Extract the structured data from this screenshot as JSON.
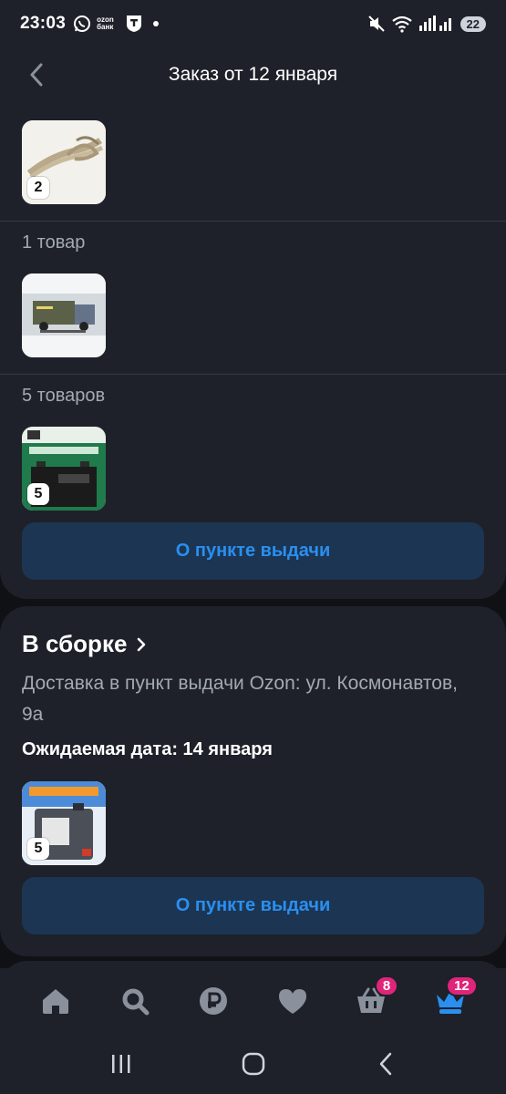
{
  "status_bar": {
    "time": "23:03",
    "ozon_label": "ozon банк",
    "battery": "22",
    "icons": [
      "whatsapp-icon",
      "ozon-bank-icon",
      "t-bank-icon",
      "mute-icon",
      "wifi-icon",
      "signal-icon"
    ]
  },
  "header": {
    "title": "Заказ от 12 января",
    "back_icon": "chevron-left-icon"
  },
  "order_card": {
    "items": [
      {
        "name": "product-rope",
        "qty": "2"
      },
      {
        "name": "product-truck-cover",
        "qty": ""
      },
      {
        "name": "product-battery",
        "qty": "5"
      }
    ],
    "group_labels": [
      "1 товар",
      "5 товаров"
    ],
    "pickup_button": "О пункте выдачи"
  },
  "assembly_card": {
    "status": "В сборке",
    "address": "Доставка в пункт выдачи Ozon: ул. Космонавтов, 9а",
    "expected_date": "Ожидаемая дата: 14 января",
    "item_qty": "5",
    "pickup_button": "О пункте выдачи"
  },
  "bottom_nav": {
    "items": [
      {
        "name": "home-icon"
      },
      {
        "name": "search-icon"
      },
      {
        "name": "ruble-icon"
      },
      {
        "name": "heart-icon"
      },
      {
        "name": "basket-icon",
        "badge": "8"
      },
      {
        "name": "crown-icon",
        "badge": "12"
      }
    ]
  },
  "colors": {
    "background": "#0f1115",
    "card": "#1e2129",
    "accent": "#2a8ff0",
    "button_bg": "#1c3553",
    "badge": "#e0247a",
    "muted_text": "#a3a9b5"
  }
}
